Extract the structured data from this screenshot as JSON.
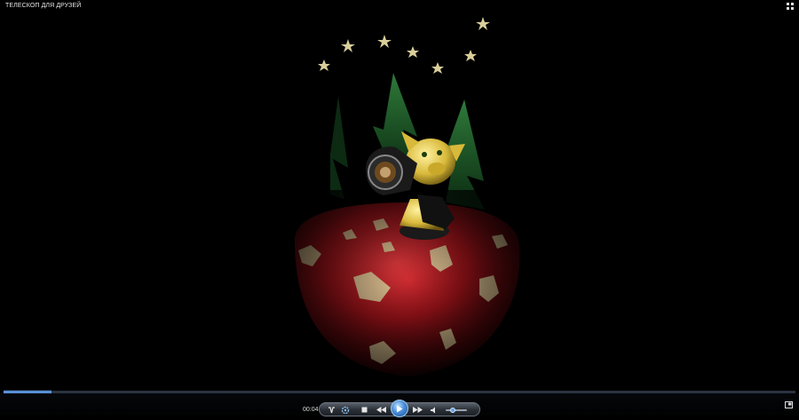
{
  "window": {
    "title": "ТЕЛЕСКОП ДЛЯ ДРУЗЕЙ"
  },
  "playback": {
    "current_time": "00:04",
    "progress_fraction": 0.06,
    "volume_fraction": 0.35,
    "state": "paused"
  },
  "icons": {
    "view_toggle": "switch-view-icon",
    "shuffle": "shuffle-icon",
    "repeat": "repeat-icon",
    "stop": "stop-icon",
    "previous": "previous-icon",
    "play": "play-icon",
    "next": "next-icon",
    "mute": "speaker-icon",
    "fullscreen": "fullscreen-icon"
  },
  "colors": {
    "accent": "#5a8fd6",
    "background": "#000000"
  }
}
